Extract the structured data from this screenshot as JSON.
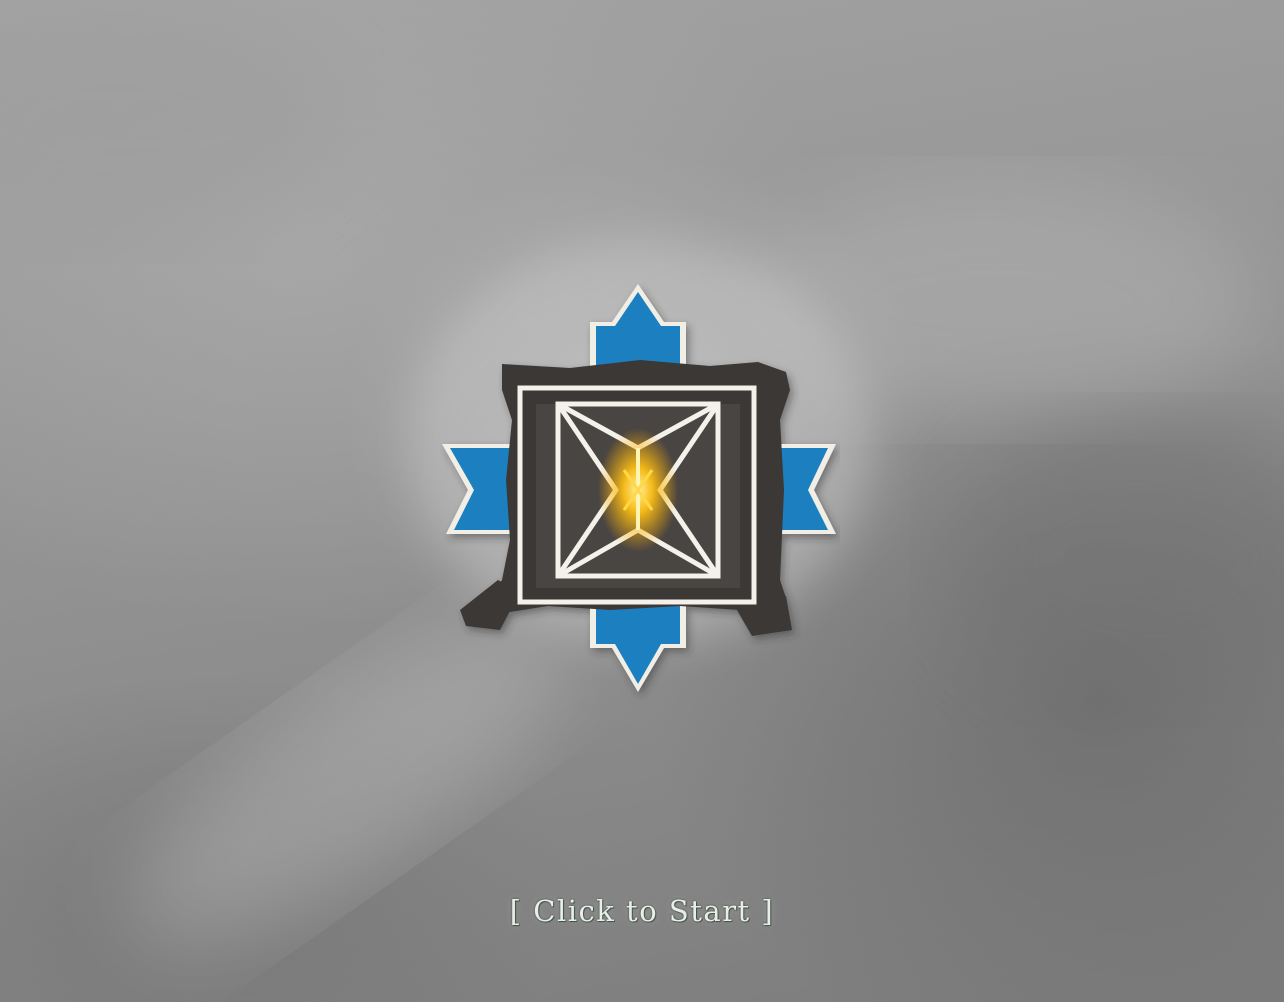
{
  "screen": {
    "name": "title-screen"
  },
  "emblem": {
    "icon": "cross-star-emblem-icon",
    "colors": {
      "blue": "#1f7fc0",
      "frame": "#3b3836",
      "outline": "#f4f1ea",
      "glow": "#ffc21a"
    }
  },
  "start": {
    "label": "[ Click to Start ]",
    "color": "#e8efe6"
  }
}
